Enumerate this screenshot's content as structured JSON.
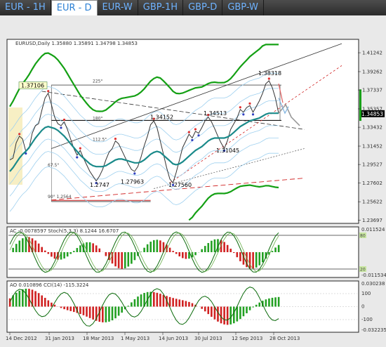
{
  "tabs": [
    {
      "label": "EUR - 1H",
      "active": false
    },
    {
      "label": "EUR - D",
      "active": true
    },
    {
      "label": "EUR-W",
      "active": false
    },
    {
      "label": "GBP-1H",
      "active": false
    },
    {
      "label": "GBP-D",
      "active": false
    },
    {
      "label": "GBP-W",
      "active": false
    }
  ],
  "chart_data": {
    "type": "line",
    "main": {
      "header": "EURUSD,Daily  1.35880 1.35891 1.34798 1.34853",
      "y_ticks": [
        "1.41242",
        "1.39262",
        "1.37337",
        "1.35357",
        "1.33432",
        "1.31452",
        "1.29527",
        "1.27602",
        "1.25622",
        "1.23697"
      ],
      "ylim": [
        1.235,
        1.425
      ],
      "current_price": "1.34853",
      "close_series": [
        1.3,
        1.302,
        1.318,
        1.325,
        1.322,
        1.309,
        1.312,
        1.328,
        1.336,
        1.338,
        1.352,
        1.365,
        1.37,
        1.358,
        1.345,
        1.338,
        1.336,
        1.34,
        1.332,
        1.322,
        1.312,
        1.305,
        1.31,
        1.302,
        1.295,
        1.288,
        1.283,
        1.278,
        1.283,
        1.29,
        1.3,
        1.308,
        1.312,
        1.32,
        1.317,
        1.31,
        1.303,
        1.296,
        1.29,
        1.288,
        1.293,
        1.303,
        1.315,
        1.325,
        1.337,
        1.341,
        1.334,
        1.32,
        1.306,
        1.292,
        1.28,
        1.276,
        1.287,
        1.3,
        1.313,
        1.32,
        1.327,
        1.323,
        1.33,
        1.328,
        1.334,
        1.341,
        1.345,
        1.34,
        1.333,
        1.325,
        1.318,
        1.312,
        1.32,
        1.332,
        1.338,
        1.344,
        1.353,
        1.35,
        1.355,
        1.357,
        1.35,
        1.356,
        1.362,
        1.37,
        1.38,
        1.383,
        1.376,
        1.365,
        1.349
      ],
      "ma_series": [
        1.288,
        1.292,
        1.297,
        1.302,
        1.306,
        1.309,
        1.313,
        1.318,
        1.323,
        1.327,
        1.331,
        1.334,
        1.335,
        1.334,
        1.333,
        1.331,
        1.328,
        1.325,
        1.321,
        1.317,
        1.313,
        1.309,
        1.305,
        1.302,
        1.299,
        1.296,
        1.294,
        1.293,
        1.293,
        1.293,
        1.294,
        1.296,
        1.298,
        1.3,
        1.301,
        1.301,
        1.3,
        1.299,
        1.298,
        1.297,
        1.297,
        1.298,
        1.3,
        1.303,
        1.306,
        1.308,
        1.309,
        1.308,
        1.305,
        1.302,
        1.299,
        1.296,
        1.295,
        1.296,
        1.298,
        1.301,
        1.304,
        1.307,
        1.31,
        1.312,
        1.314,
        1.317,
        1.32,
        1.322,
        1.323,
        1.323,
        1.323,
        1.323,
        1.324,
        1.326,
        1.329,
        1.332,
        1.335,
        1.337,
        1.339,
        1.341,
        1.342,
        1.343,
        1.344,
        1.346,
        1.348,
        1.349,
        1.349,
        1.349,
        1.349
      ],
      "annotations": [
        {
          "text": "1.37106"
        },
        {
          "text": "1.38318"
        },
        {
          "text": "1.34152"
        },
        {
          "text": "1.34513"
        },
        {
          "text": "1.31045"
        },
        {
          "text": "1.2747"
        },
        {
          "text": "1.27963"
        },
        {
          "text": "1.27560"
        },
        {
          "text": "225°"
        },
        {
          "text": "180°"
        },
        {
          "text": "112.5°"
        },
        {
          "text": "67.5°"
        },
        {
          "text": "90° 1.2564"
        }
      ]
    },
    "ac_stoch": {
      "header": "AC -0.0078597  Stoch(5,3,3) 8.1244  16.6707",
      "y_ticks": [
        "0.011524",
        "-0.011534"
      ],
      "levels": [
        "80",
        "20"
      ]
    },
    "ao_cci": {
      "header": "AO 0.010896  CCI(14) -115.3224",
      "y_ticks": [
        "0.030238",
        "100",
        "0",
        "-100",
        "-0.032235"
      ]
    },
    "x_ticks": [
      "14 Dec 2012",
      "31 Jan 2013",
      "18 Mar 2013",
      "1 May 2013",
      "14 Jun 2013",
      "30 Jul 2013",
      "12 Sep 2013",
      "28 Oct 2013"
    ]
  }
}
